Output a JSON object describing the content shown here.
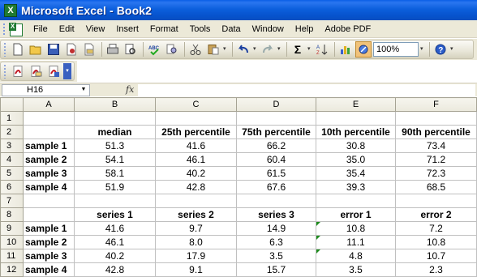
{
  "window": {
    "title": "Microsoft Excel - Book2",
    "app_icon_letter": "X"
  },
  "menu": [
    "File",
    "Edit",
    "View",
    "Insert",
    "Format",
    "Tools",
    "Data",
    "Window",
    "Help",
    "Adobe PDF"
  ],
  "toolbar": {
    "zoom": "100%"
  },
  "formula_bar": {
    "name_box": "H16",
    "fx": "fx",
    "content": ""
  },
  "columns": [
    "A",
    "B",
    "C",
    "D",
    "E",
    "F"
  ],
  "rows": [
    {
      "n": "1",
      "cells": [
        "",
        "",
        "",
        "",
        "",
        ""
      ]
    },
    {
      "n": "2",
      "cells": [
        "",
        "median",
        "25th percentile",
        "75th percentile",
        "10th percentile",
        "90th percentile"
      ]
    },
    {
      "n": "3",
      "cells": [
        "sample 1",
        "51.3",
        "41.6",
        "66.2",
        "30.8",
        "73.4"
      ]
    },
    {
      "n": "4",
      "cells": [
        "sample 2",
        "54.1",
        "46.1",
        "60.4",
        "35.0",
        "71.2"
      ]
    },
    {
      "n": "5",
      "cells": [
        "sample 3",
        "58.1",
        "40.2",
        "61.5",
        "35.4",
        "72.3"
      ]
    },
    {
      "n": "6",
      "cells": [
        "sample 4",
        "51.9",
        "42.8",
        "67.6",
        "39.3",
        "68.5"
      ]
    },
    {
      "n": "7",
      "cells": [
        "",
        "",
        "",
        "",
        "",
        ""
      ]
    },
    {
      "n": "8",
      "cells": [
        "",
        "series 1",
        "series 2",
        "series 3",
        "error 1",
        "error 2"
      ]
    },
    {
      "n": "9",
      "cells": [
        "sample 1",
        "41.6",
        "9.7",
        "14.9",
        "10.8",
        "7.2"
      ]
    },
    {
      "n": "10",
      "cells": [
        "sample 2",
        "46.1",
        "8.0",
        "6.3",
        "11.1",
        "10.8"
      ]
    },
    {
      "n": "11",
      "cells": [
        "sample 3",
        "40.2",
        "17.9",
        "3.5",
        "4.8",
        "10.7"
      ]
    },
    {
      "n": "12",
      "cells": [
        "sample 4",
        "42.8",
        "9.1",
        "15.7",
        "3.5",
        "2.3"
      ]
    }
  ]
}
